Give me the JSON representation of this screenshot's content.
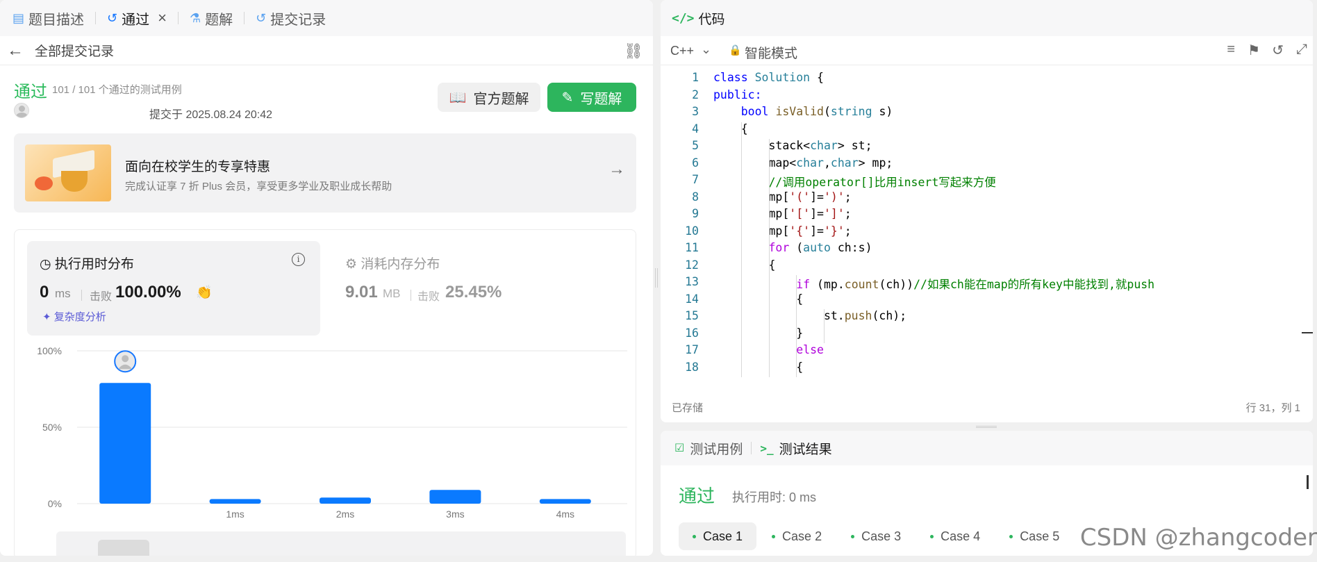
{
  "tabs": [
    {
      "label": "题目描述",
      "icon": "document-icon"
    },
    {
      "label": "通过",
      "icon": "history-icon",
      "active": true
    },
    {
      "label": "题解",
      "icon": "flask-icon"
    },
    {
      "label": "提交记录",
      "icon": "history-icon"
    }
  ],
  "back": {
    "label": "全部提交记录"
  },
  "submission": {
    "status": "通过",
    "cases_summary": "101 / 101 个通过的测试用例",
    "submitted_at": "提交于 2025.08.24 20:42"
  },
  "buttons": {
    "official": "官方题解",
    "write": "写题解"
  },
  "promo": {
    "title": "面向在校学生的专享特惠",
    "desc": "完成认证享 7 折 Plus 会员，享受更多学业及职业成长帮助"
  },
  "runtime": {
    "title": "执行用时分布",
    "value": "0",
    "unit": "ms",
    "beat_label": "击败",
    "beat": "100.00%",
    "analysis": "复杂度分析"
  },
  "memory": {
    "title": "消耗内存分布",
    "value": "9.01",
    "unit": "MB",
    "beat_label": "击败",
    "beat": "25.45%"
  },
  "chart_data": {
    "type": "bar",
    "categories": [
      "",
      "1ms",
      "2ms",
      "3ms",
      "4ms"
    ],
    "values": [
      79,
      3,
      4,
      9,
      3
    ],
    "ylim": [
      0,
      100
    ],
    "yticks": [
      "100%",
      "50%",
      "0%"
    ],
    "highlight_index": 0,
    "bar_color": "#0a7aff",
    "grid": true
  },
  "editor": {
    "title": "代码",
    "language": "C++",
    "mode": "智能模式",
    "saved": "已存储",
    "position": "行 31，列 1",
    "lines": [
      "class Solution {",
      "public:",
      "    bool isValid(string s)",
      "    {",
      "        stack<char> st;",
      "        map<char,char> mp;",
      "        //调用operator[]比用insert写起来方便",
      "        mp['(']=')';",
      "        mp['[']=']';",
      "        mp['{']='}';",
      "        for (auto ch:s)",
      "        {",
      "            if (mp.count(ch))//如果ch能在map的所有key中能找到,就push",
      "            {",
      "                st.push(ch);",
      "            }",
      "            else",
      "            {"
    ]
  },
  "result": {
    "tab_cases": "测试用例",
    "tab_result": "测试结果",
    "status": "通过",
    "time": "执行用时: 0 ms",
    "cases": [
      "Case 1",
      "Case 2",
      "Case 3",
      "Case 4",
      "Case 5"
    ]
  },
  "watermark": "CSDN @zhangcoder",
  "colors": {
    "accent_green": "#2db55d",
    "bar_blue": "#0a7aff",
    "purple": "#5b5bd6"
  }
}
